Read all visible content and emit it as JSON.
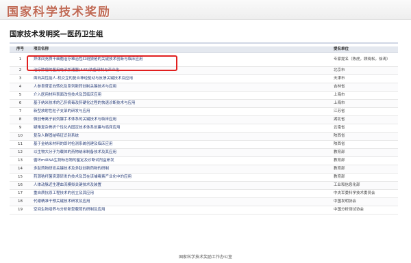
{
  "banner": {
    "title": "国家科学技术奖励"
  },
  "heading": "国家技术发明奖—医药卫生组",
  "table": {
    "headers": {
      "no": "序号",
      "name": "项目名称",
      "unit": "提名单位"
    },
    "rows": [
      {
        "no": "1",
        "name": "异体间充质干细胞治疗难治性红斑狼疮的关键技术创新与临床应用",
        "unit": "专家提名（陈虎，顾晓松，徐涛）"
      },
      {
        "no": "2",
        "name": "治疗肿瘤的医用电子加速器(A45)装备研制与产业化",
        "unit": "北京市"
      },
      {
        "no": "3",
        "name": "面向高性能人-机交互的复合神经驱动与反馈关键技术及应用",
        "unit": "天津市"
      },
      {
        "no": "4",
        "name": "人参皂苷定向转化及系列新药创制关键技术与应用",
        "unit": "吉林省"
      },
      {
        "no": "5",
        "name": "介入医用材料表面改性技术及其临床应用",
        "unit": "上海市"
      },
      {
        "no": "6",
        "name": "基于纳米技术的乙肝病毒及肝硬化过程的快速诊断技术与应用",
        "unit": "上海市"
      },
      {
        "no": "7",
        "name": "新型放射性粒子支架的研发与应用",
        "unit": "江苏省"
      },
      {
        "no": "8",
        "name": "微创骨离子前列腺手术体系的关键技术与临床应用",
        "unit": "湖北省"
      },
      {
        "no": "9",
        "name": "疑难复杂骨折个性化内固定技术体系创建与临床应用",
        "unit": "云南省"
      },
      {
        "no": "10",
        "name": "复杂人群固结特征识别系统",
        "unit": "陕西省"
      },
      {
        "no": "11",
        "name": "基于金纳米材料的即时检测系统创建及临床应用",
        "unit": "陕西省"
      },
      {
        "no": "12",
        "name": "以生物大分子为载体的药物纳米制备技术及其应用",
        "unit": "教育部"
      },
      {
        "no": "13",
        "name": "循环miRNA生物标志物的鉴定及诊断试剂盒研发",
        "unit": "教育部"
      },
      {
        "no": "14",
        "name": "多肽药物研发关键技术及多肽创新药物的研制",
        "unit": "教育部"
      },
      {
        "no": "15",
        "name": "药源秸秆菌资源研发的技术及其在该埔霉素产业化中的应用",
        "unit": "教育部"
      },
      {
        "no": "16",
        "name": "人体动脉近生理血流模拟关键技术及装置",
        "unit": "工业和信息化部"
      },
      {
        "no": "17",
        "name": "重自质抗原工程技术的创立及其应用",
        "unit": "中央军委科学技术委员会"
      },
      {
        "no": "18",
        "name": "代谢精准干预关键技术研发及应用",
        "unit": "中国发明协会"
      },
      {
        "no": "19",
        "name": "空间生物培养与分析新型载荷的研制及应用",
        "unit": "中国分析测试协会"
      }
    ]
  },
  "footer": "国家科学技术奖励工作办公室"
}
